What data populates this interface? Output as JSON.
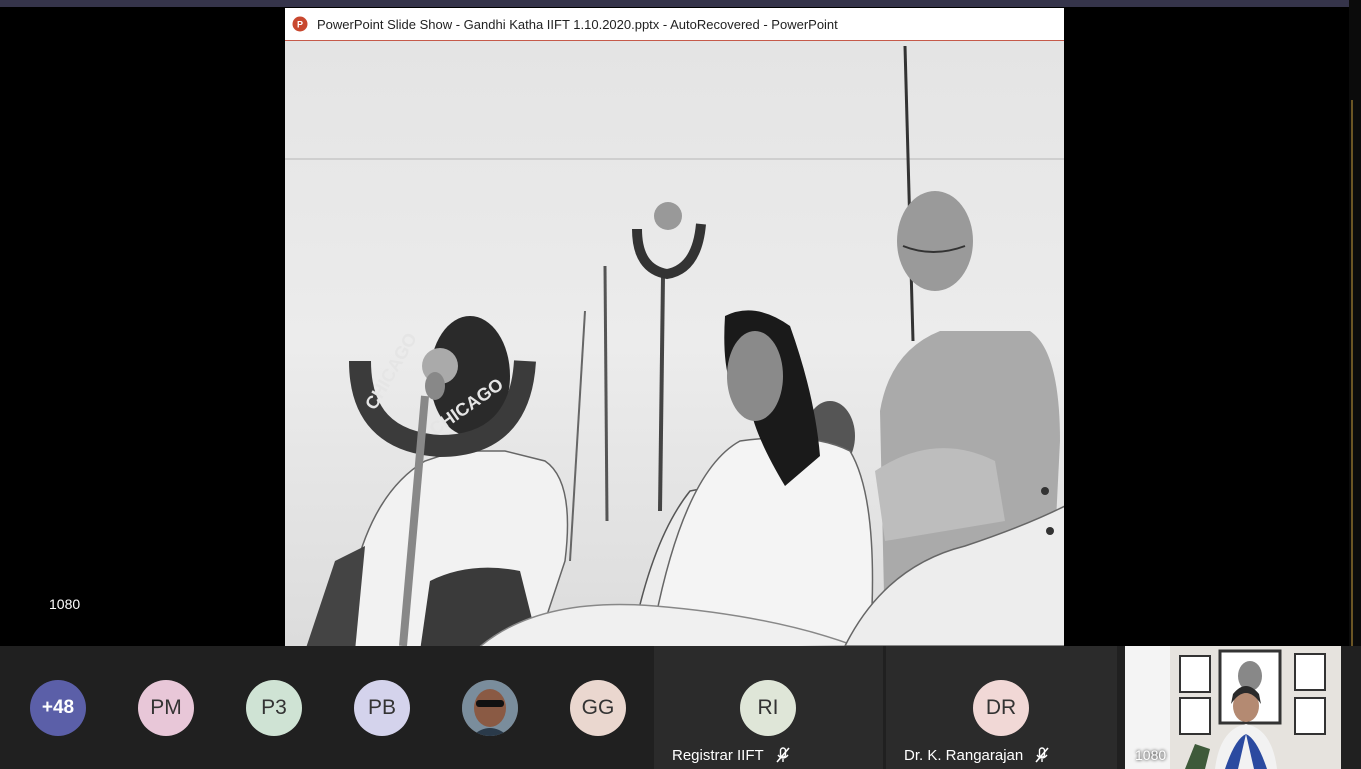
{
  "window": {
    "title": "PowerPoint Slide Show  -  Gandhi Katha IIFT 1.10.2020.pptx  -  AutoRecovered - PowerPoint",
    "icon": "powerpoint-icon"
  },
  "slide": {
    "microphone_text_left": "CHICAGO",
    "microphone_text_right": "CHICAGO"
  },
  "resolution_label": "1080",
  "participants": [
    {
      "initials": "+48",
      "bg": "#5b5fa8",
      "fg": "#ffffff"
    },
    {
      "initials": "PM",
      "bg": "#e8c7d8",
      "fg": "#333333"
    },
    {
      "initials": "P3",
      "bg": "#cfe3d4",
      "fg": "#333333"
    },
    {
      "initials": "PB",
      "bg": "#d4d3ec",
      "fg": "#333333"
    },
    {
      "initials": "",
      "bg": "#5a4a3f",
      "fg": "#ffffff",
      "photo": true
    },
    {
      "initials": "GG",
      "bg": "#ead7cf",
      "fg": "#333333"
    }
  ],
  "speakers": [
    {
      "initials": "RI",
      "name": "Registrar IIFT",
      "bg": "#dfe6d8",
      "fg": "#333333",
      "icon": "mic-off-icon"
    },
    {
      "initials": "DR",
      "name": "Dr. K. Rangarajan",
      "bg": "#f1d8d6",
      "fg": "#333333",
      "icon": "mic-off-icon"
    }
  ],
  "self_view": {
    "label": "1080"
  }
}
